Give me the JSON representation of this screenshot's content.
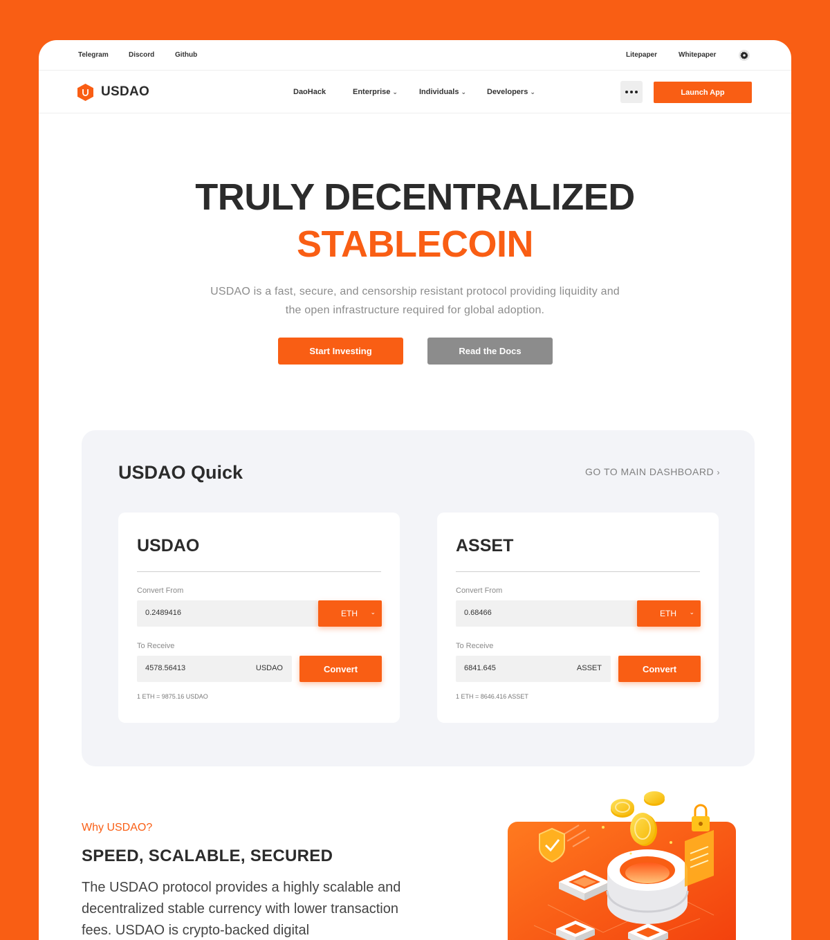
{
  "topbar": {
    "left_links": [
      "Telegram",
      "Discord",
      "Github"
    ],
    "right_links": [
      "Litepaper",
      "Whitepaper"
    ],
    "settings_icon": "gear-icon"
  },
  "nav": {
    "brand": "USDAO",
    "logo_icon": "hexagon-u-logo",
    "links": [
      "DaoHack",
      "Enterprise",
      "Individuals",
      "Developers"
    ],
    "more_icon": "ellipsis-icon",
    "launch_label": "Launch App"
  },
  "hero": {
    "line1": "TRULY DECENTRALIZED",
    "line2": "STABLECOIN",
    "subtitle": "USDAO is a fast, secure, and censorship resistant protocol providing liquidity and the open infrastructure required for global adoption.",
    "primary_cta": "Start Investing",
    "secondary_cta": "Read the Docs"
  },
  "quick": {
    "title": "USDAO Quick",
    "dashboard_link": "GO TO MAIN DASHBOARD",
    "cards": [
      {
        "title": "USDAO",
        "convert_from_label": "Convert From",
        "from_value": "0.2489416",
        "from_currency": "ETH",
        "to_receive_label": "To Receive",
        "receive_value": "4578.56413",
        "receive_unit": "USDAO",
        "convert_label": "Convert",
        "rate": "1 ETH = 9875.16 USDAO"
      },
      {
        "title": "ASSET",
        "convert_from_label": "Convert From",
        "from_value": "0.68466",
        "from_currency": "ETH",
        "to_receive_label": "To Receive",
        "receive_value": "6841.645",
        "receive_unit": "ASSET",
        "convert_label": "Convert",
        "rate": "1 ETH = 8646.416 ASSET"
      }
    ]
  },
  "why": {
    "kicker": "Why USDAO?",
    "title": "SPEED, SCALABLE, SECURED",
    "text": "The USDAO protocol provides a highly scalable and decentralized stable currency with lower transaction fees. USDAO is crypto-backed digital"
  },
  "colors": {
    "accent": "#F95E14",
    "panel": "#f3f4f8",
    "muted_button": "#8c8c8c",
    "ink": "#2b2b2b"
  }
}
